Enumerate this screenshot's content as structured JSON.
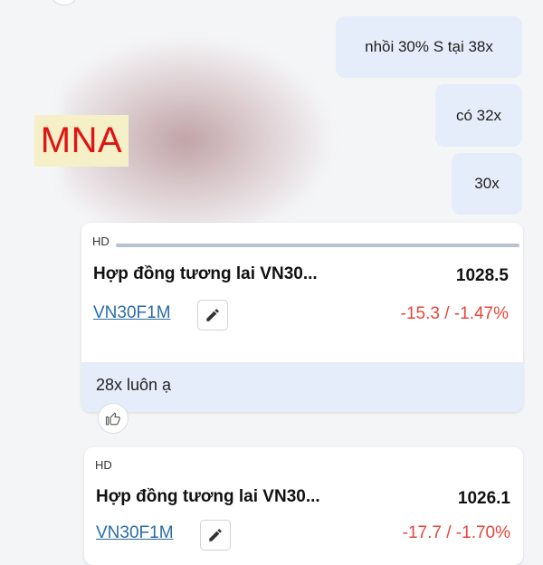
{
  "messages": [
    {
      "text": "nhồi 30% S tại 38x"
    },
    {
      "text": "có 32x"
    },
    {
      "text": "30x"
    }
  ],
  "watermark": "MNA",
  "cards": [
    {
      "tag": "HD",
      "title": "Hợp đồng tương lai VN30...",
      "price": "1028.5",
      "symbol": "VN30F1M",
      "change": "-15.3 / -1.47%",
      "footer": "28x luôn ạ"
    },
    {
      "tag": "HD",
      "title": "Hợp đồng tương lai VN30...",
      "price": "1026.1",
      "symbol": "VN30F1M",
      "change": "-17.7 / -1.70%"
    }
  ],
  "colors": {
    "bubble": "#e5edfa",
    "negative": "#e5463c",
    "link": "#2c6da3",
    "watermark": "#e01414"
  },
  "icons": [
    "pencil-icon",
    "thumbs-up-icon"
  ]
}
